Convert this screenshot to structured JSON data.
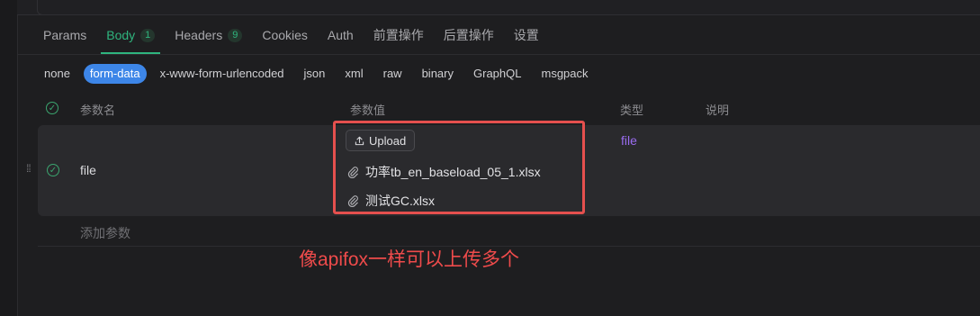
{
  "tabs": [
    {
      "label": "Params"
    },
    {
      "label": "Body",
      "badge": "1",
      "active": true
    },
    {
      "label": "Headers",
      "badge": "9"
    },
    {
      "label": "Cookies"
    },
    {
      "label": "Auth"
    },
    {
      "label": "前置操作"
    },
    {
      "label": "后置操作"
    },
    {
      "label": "设置"
    }
  ],
  "body_types": [
    "none",
    "form-data",
    "x-www-form-urlencoded",
    "json",
    "xml",
    "raw",
    "binary",
    "GraphQL",
    "msgpack"
  ],
  "body_type_selected": "form-data",
  "table": {
    "headers": {
      "name": "参数名",
      "value": "参数值",
      "type": "类型",
      "desc": "说明"
    },
    "rows": [
      {
        "name": "file",
        "type": "file",
        "upload_label": "Upload",
        "files": [
          "功率tb_en_baseload_05_1.xlsx",
          "测试GC.xlsx"
        ]
      }
    ],
    "add_param_label": "添加参数"
  },
  "annotation": "像apifox一样可以上传多个",
  "colors": {
    "accent_green": "#2fb57e",
    "pill_blue": "#3d86e8",
    "type_purple": "#9a6cf0",
    "annotation_red": "#e5504e"
  }
}
